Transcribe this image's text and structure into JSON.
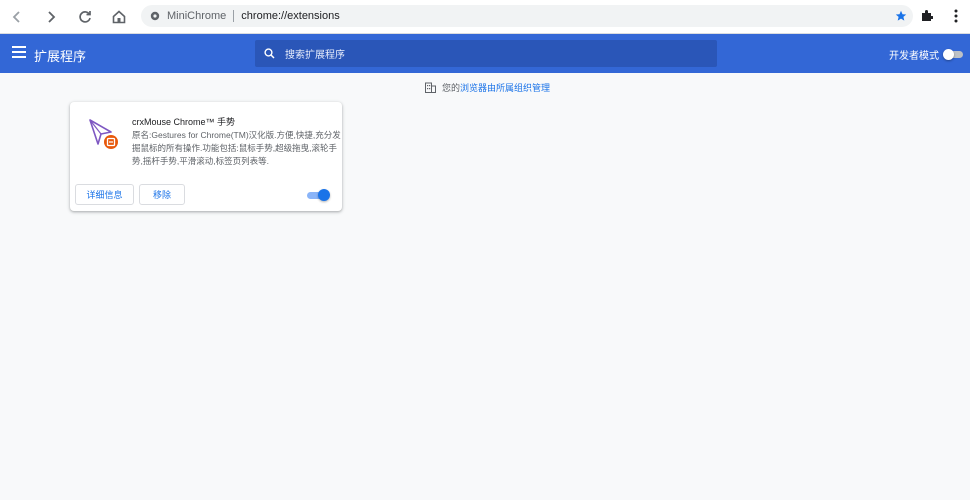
{
  "browser": {
    "site_name": "MiniChrome",
    "url": "chrome://extensions",
    "bookmark_color": "#1a73e8"
  },
  "extensions_page": {
    "title": "扩展程序",
    "search_placeholder": "搜索扩展程序",
    "dev_mode_label": "开发者模式",
    "dev_mode_on": false,
    "header_color": "#3367d6",
    "managed_prefix": "您的",
    "managed_link": "浏览器由所属组织管理"
  },
  "extensions": [
    {
      "name": "crxMouse Chrome™ 手势",
      "description": "原名:Gestures for Chrome(TM)汉化版.方便,快捷,充分发掘鼠标的所有操作.功能包括:鼠标手势,超级拖曳,滚轮手势,摇杆手势,平滑滚动,标签页列表等.",
      "details_label": "详细信息",
      "remove_label": "移除",
      "enabled": true,
      "icon": "mouse-cursor-icon"
    }
  ]
}
